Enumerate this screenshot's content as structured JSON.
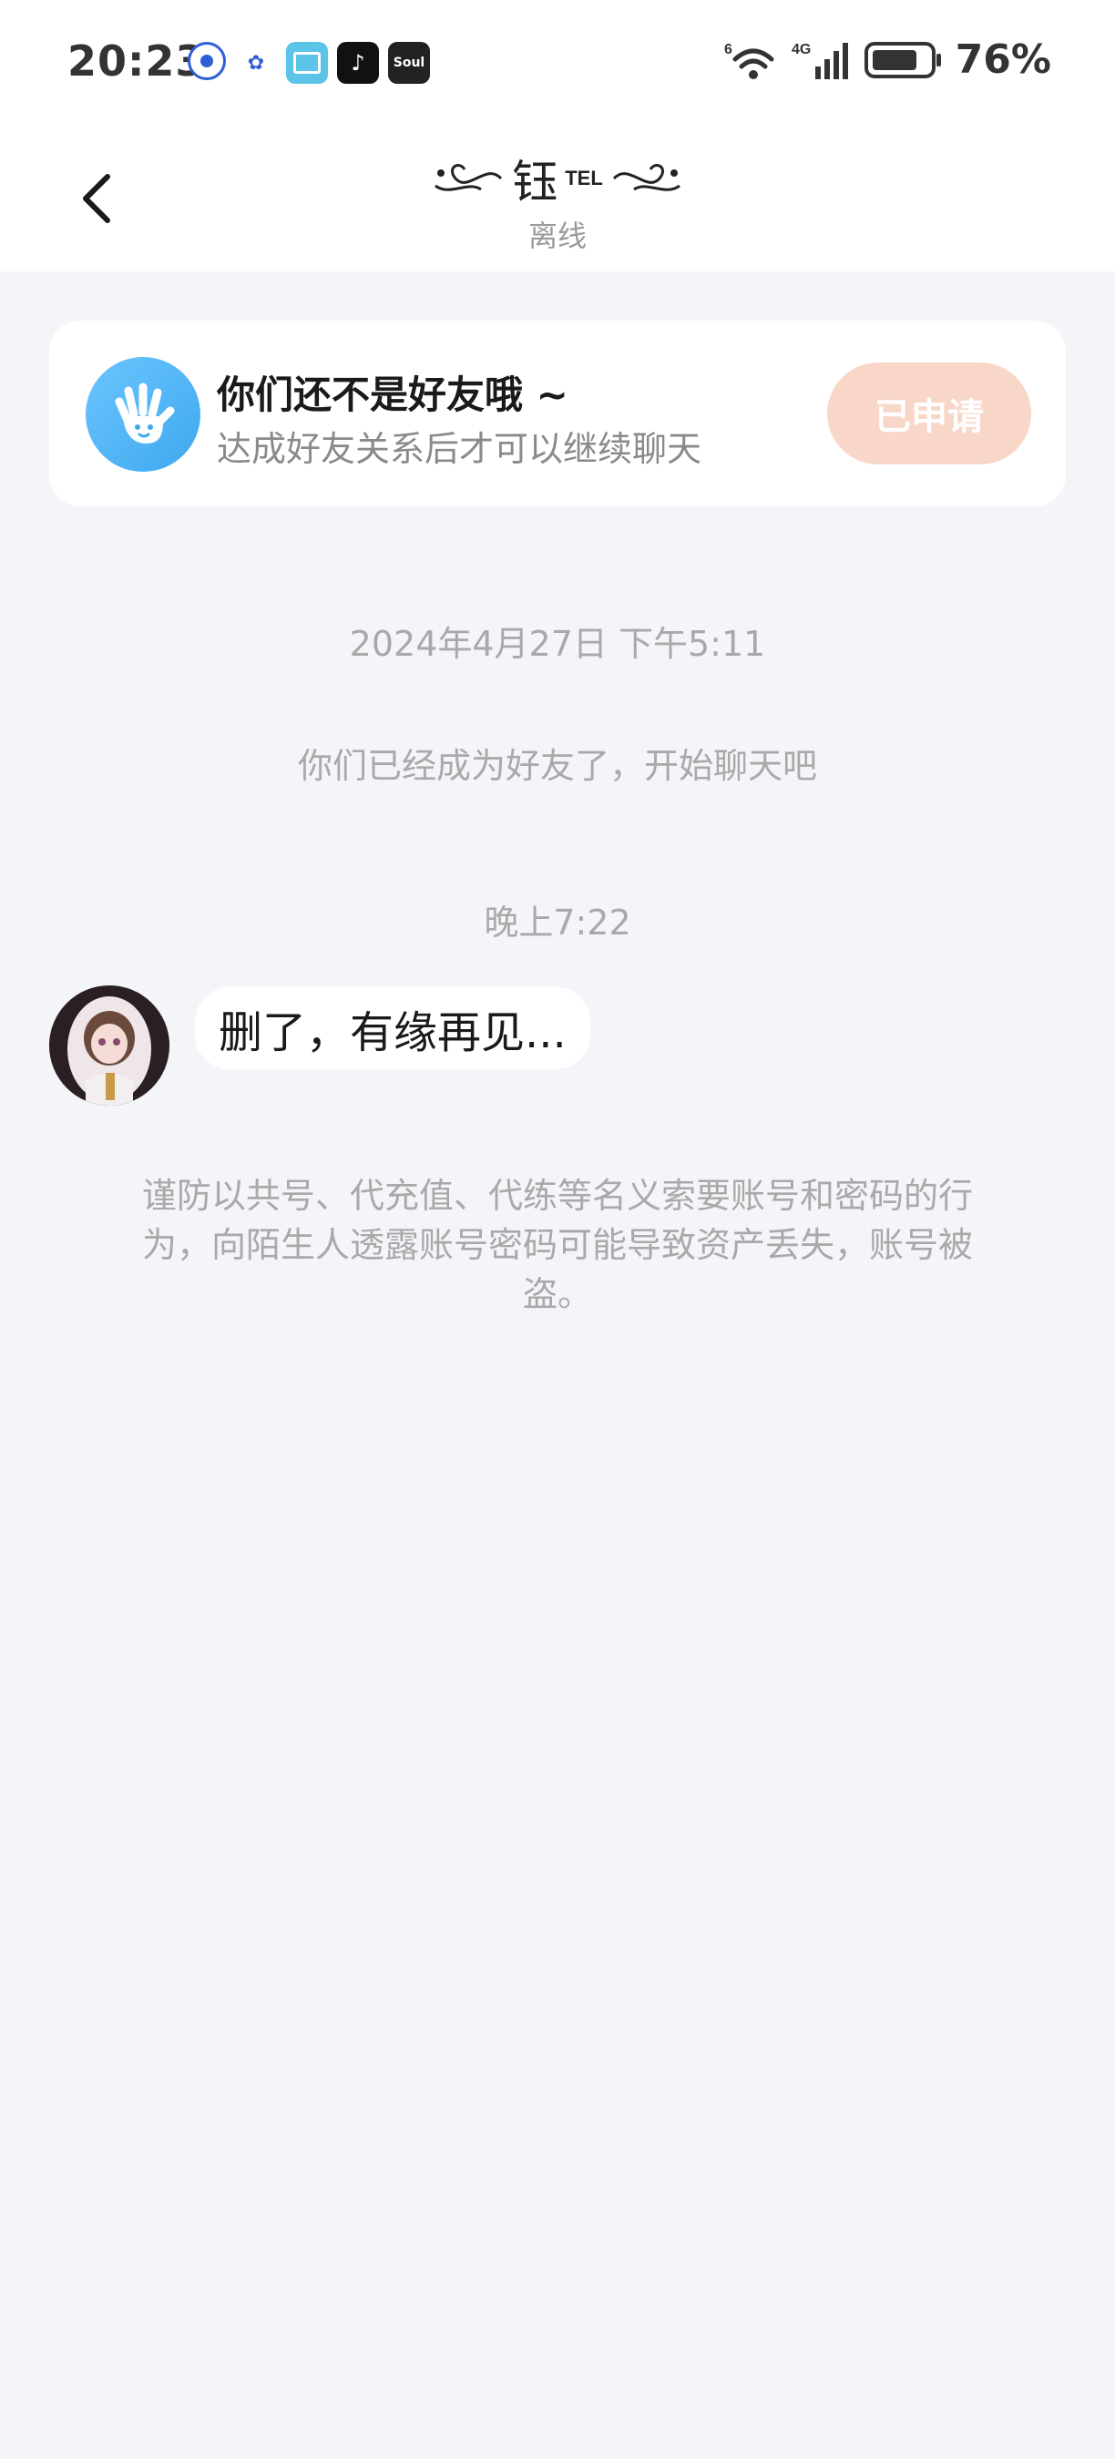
{
  "status_bar": {
    "time": "20:23",
    "notification_icons": [
      "location-app-icon",
      "baidu-icon",
      "reader-app-icon",
      "tiktok-icon",
      "soul-app-icon"
    ],
    "soul_label": "Soul",
    "network": "4G",
    "wifi_label": "6",
    "battery": "76%"
  },
  "header": {
    "title": "钰",
    "title_suffix": "TEL",
    "status": "离线"
  },
  "friend_notice": {
    "title": "你们还不是好友哦 ~",
    "subtitle": "达成好友关系后才可以继续聊天",
    "button_label": "已申请",
    "button_color": "#f8d7c9"
  },
  "chat": {
    "timestamp_1": "2024年4月27日 下午5:11",
    "system_message": "你们已经成为好友了，开始聊天吧",
    "timestamp_2": "晚上7:22",
    "messages": [
      {
        "text": "删了，有缘再见..."
      }
    ],
    "warning": "谨防以共号、代充值、代练等名义索要账号和密码的行为，向陌生人透露账号密码可能导致资产丢失，账号被盗。"
  }
}
